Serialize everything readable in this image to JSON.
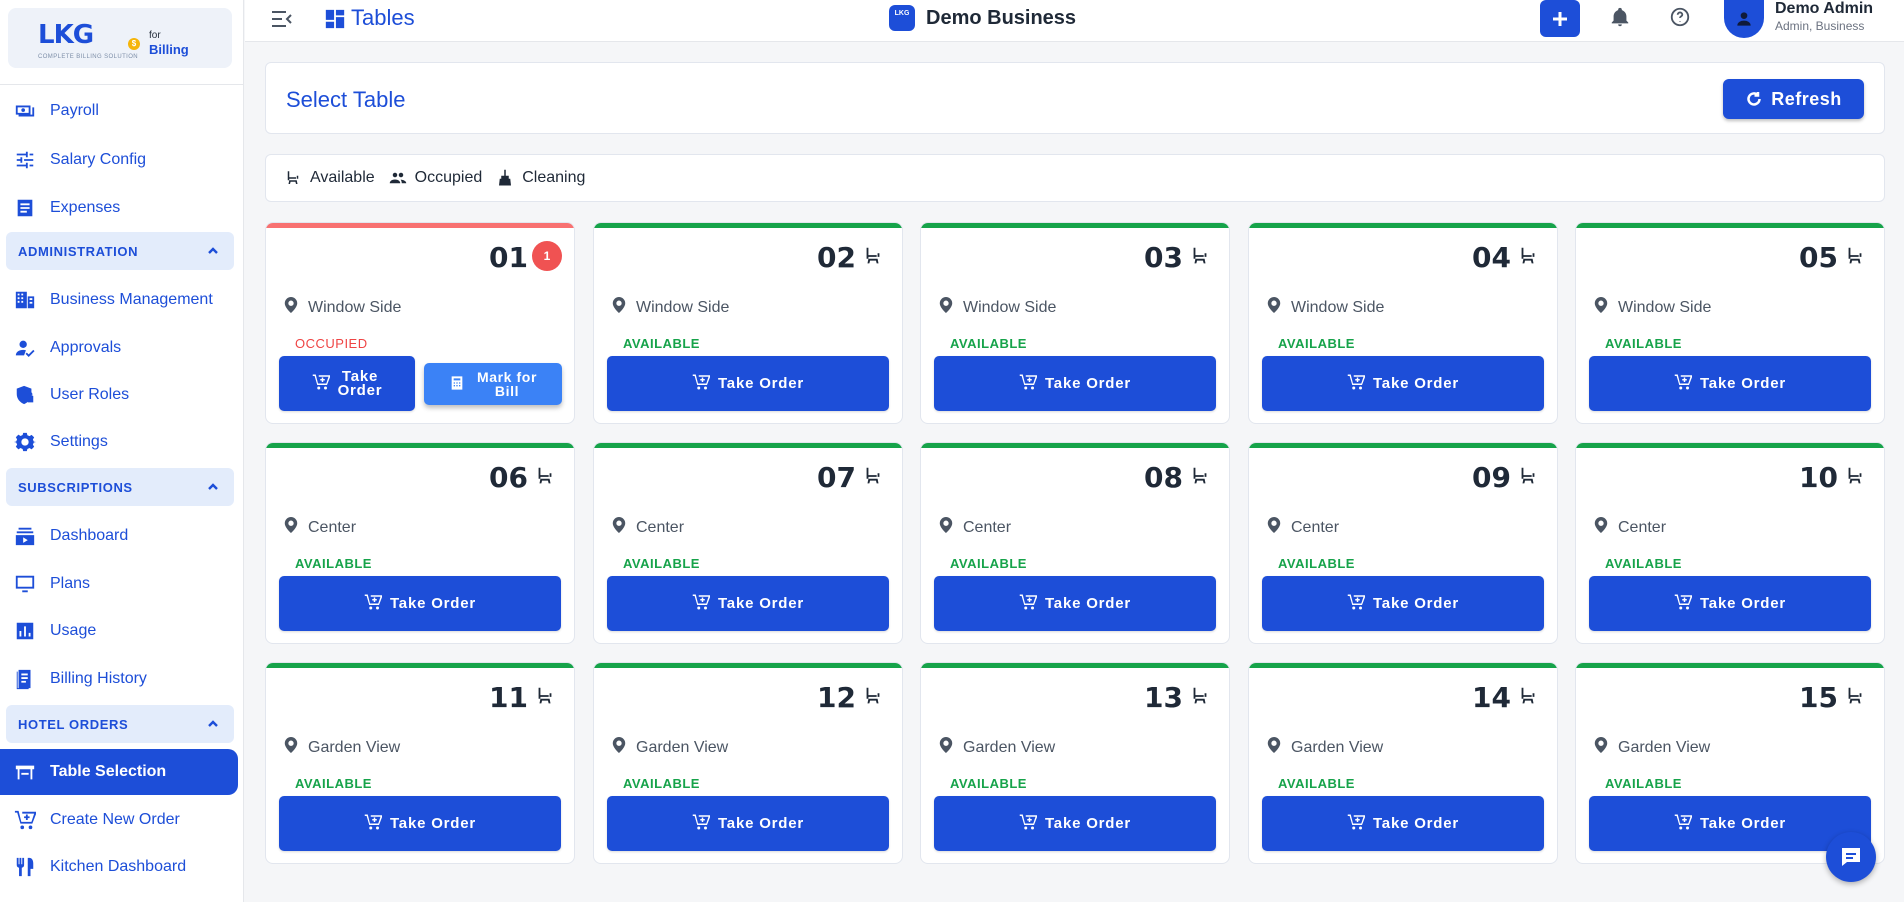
{
  "logo": {
    "main": "LKG",
    "for": "for",
    "billing": "Billing",
    "tagline": "COMPLETE BILLING SOLUTION",
    "coin": "$"
  },
  "sidebar": {
    "items_top": [
      {
        "label": "Payroll",
        "icon": "payroll-icon"
      },
      {
        "label": "Salary Config",
        "icon": "sliders-icon"
      },
      {
        "label": "Expenses",
        "icon": "expenses-icon"
      }
    ],
    "administration": {
      "label": "ADMINISTRATION",
      "items": [
        {
          "label": "Business Management",
          "icon": "building-icon"
        },
        {
          "label": "Approvals",
          "icon": "approval-user-icon"
        },
        {
          "label": "User Roles",
          "icon": "shield-lock-icon"
        },
        {
          "label": "Settings",
          "icon": "gear-icon"
        }
      ]
    },
    "subscriptions": {
      "label": "SUBSCRIPTIONS",
      "items": [
        {
          "label": "Dashboard",
          "icon": "subscriptions-icon"
        },
        {
          "label": "Plans",
          "icon": "monitor-icon"
        },
        {
          "label": "Usage",
          "icon": "bar-chart-icon"
        },
        {
          "label": "Billing History",
          "icon": "receipt-icon"
        }
      ]
    },
    "hotel_orders": {
      "label": "HOTEL ORDERS",
      "items": [
        {
          "label": "Table Selection",
          "icon": "table-icon",
          "active": true
        },
        {
          "label": "Create New Order",
          "icon": "cart-add-icon"
        },
        {
          "label": "Kitchen Dashboard",
          "icon": "utensils-icon"
        }
      ]
    }
  },
  "topbar": {
    "title": "Tables",
    "business_logo": "LKG",
    "business": "Demo Business",
    "user_name": "Demo Admin",
    "user_role": "Admin, Business"
  },
  "header": {
    "title": "Select Table",
    "refresh_label": "Refresh"
  },
  "legend": [
    {
      "label": "Available",
      "icon": "seat-icon"
    },
    {
      "label": "Occupied",
      "icon": "people-icon"
    },
    {
      "label": "Cleaning",
      "icon": "broom-icon"
    }
  ],
  "tables": [
    {
      "number": "01",
      "location": "Window Side",
      "status": "OCCUPIED",
      "badge": "1",
      "take_order": "Take\nOrder",
      "mark_bill": "Mark for\nBill"
    },
    {
      "number": "02",
      "location": "Window Side",
      "status": "AVAILABLE",
      "take_order": "Take Order"
    },
    {
      "number": "03",
      "location": "Window Side",
      "status": "AVAILABLE",
      "take_order": "Take Order"
    },
    {
      "number": "04",
      "location": "Window Side",
      "status": "AVAILABLE",
      "take_order": "Take Order"
    },
    {
      "number": "05",
      "location": "Window Side",
      "status": "AVAILABLE",
      "take_order": "Take Order"
    },
    {
      "number": "06",
      "location": "Center",
      "status": "AVAILABLE",
      "take_order": "Take Order"
    },
    {
      "number": "07",
      "location": "Center",
      "status": "AVAILABLE",
      "take_order": "Take Order"
    },
    {
      "number": "08",
      "location": "Center",
      "status": "AVAILABLE",
      "take_order": "Take Order"
    },
    {
      "number": "09",
      "location": "Center",
      "status": "AVAILABLE",
      "take_order": "Take Order"
    },
    {
      "number": "10",
      "location": "Center",
      "status": "AVAILABLE",
      "take_order": "Take Order"
    },
    {
      "number": "11",
      "location": "Garden View",
      "status": "AVAILABLE",
      "take_order": "Take Order"
    },
    {
      "number": "12",
      "location": "Garden View",
      "status": "AVAILABLE",
      "take_order": "Take Order"
    },
    {
      "number": "13",
      "location": "Garden View",
      "status": "AVAILABLE",
      "take_order": "Take Order"
    },
    {
      "number": "14",
      "location": "Garden View",
      "status": "AVAILABLE",
      "take_order": "Take Order"
    },
    {
      "number": "15",
      "location": "Garden View",
      "status": "AVAILABLE",
      "take_order": "Take Order"
    }
  ],
  "colors": {
    "primary": "#1d4ed8",
    "available": "#16a34a",
    "occupied": "#ef4444",
    "bill_button": "#3b82f6"
  }
}
